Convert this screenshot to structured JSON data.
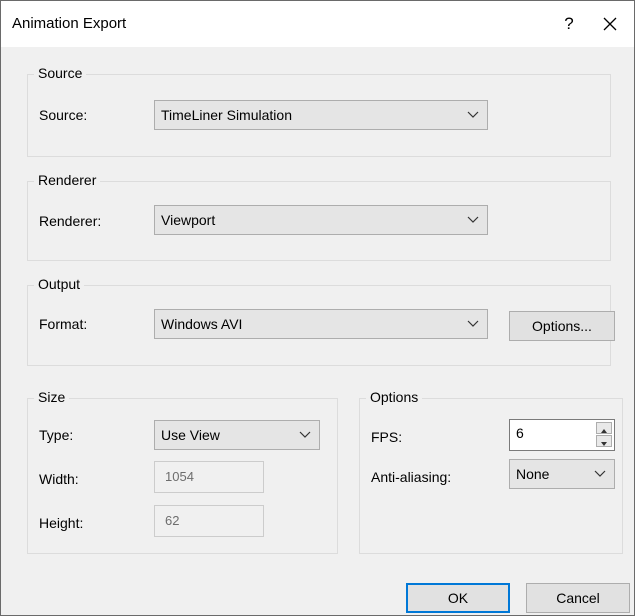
{
  "dialog": {
    "title": "Animation Export",
    "help": "?",
    "close": "✕"
  },
  "source": {
    "group_title": "Source",
    "label": "Source:",
    "value": "TimeLiner Simulation"
  },
  "renderer": {
    "group_title": "Renderer",
    "label": "Renderer:",
    "value": "Viewport"
  },
  "output": {
    "group_title": "Output",
    "label": "Format:",
    "value": "Windows AVI",
    "options_button": "Options..."
  },
  "size": {
    "group_title": "Size",
    "type_label": "Type:",
    "type_value": "Use View",
    "width_label": "Width:",
    "width_value": "1054",
    "height_label": "Height:",
    "height_value": "62"
  },
  "options": {
    "group_title": "Options",
    "fps_label": "FPS:",
    "fps_value": "6",
    "aa_label": "Anti-aliasing:",
    "aa_value": "None"
  },
  "buttons": {
    "ok": "OK",
    "cancel": "Cancel"
  },
  "colors": {
    "default_button_border": "#0078d7",
    "dialog_bg": "#f0f0f0",
    "titlebar_bg": "#ffffff"
  }
}
